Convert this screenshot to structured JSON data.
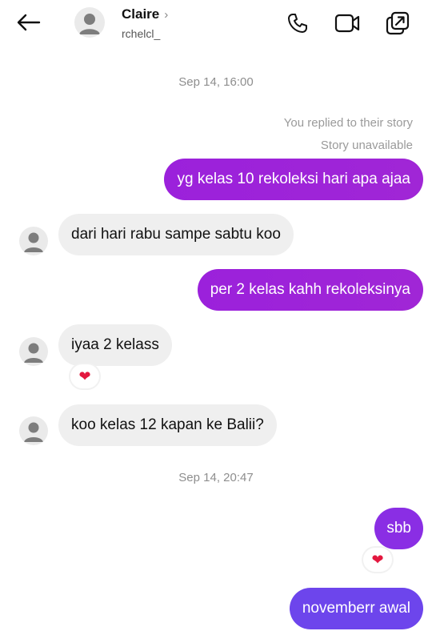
{
  "header": {
    "name": "Claire",
    "chevron": "›",
    "handle": "rchelcl_",
    "icons": [
      "back-arrow-icon",
      "phone-icon",
      "video-icon",
      "share-window-icon"
    ]
  },
  "thread": {
    "timestamps": [
      "Sep 14, 16:00",
      "Sep 14, 20:47"
    ],
    "story_note": {
      "line1": "You replied to their story",
      "line2": "Story unavailable"
    },
    "messages": [
      {
        "from": "me",
        "text": "yg kelas 10 rekoleksi hari apa ajaa"
      },
      {
        "from": "them",
        "text": "dari hari rabu sampe sabtu koo"
      },
      {
        "from": "me",
        "text": "per 2 kelas kahh rekoleksinya"
      },
      {
        "from": "them",
        "text": "iyaa 2 kelass",
        "reaction": "❤"
      },
      {
        "from": "them",
        "text": "koo kelas 12 kapan ke Balii?"
      },
      {
        "from": "me",
        "text": "sbb",
        "reaction": "❤"
      },
      {
        "from": "me",
        "text": "novemberr awal"
      }
    ]
  },
  "colors": {
    "outgoing_purple": "#9b21db",
    "outgoing_blue": "#6d45ec",
    "incoming_gray": "#efefef",
    "reaction_heart": "#e3173e"
  }
}
